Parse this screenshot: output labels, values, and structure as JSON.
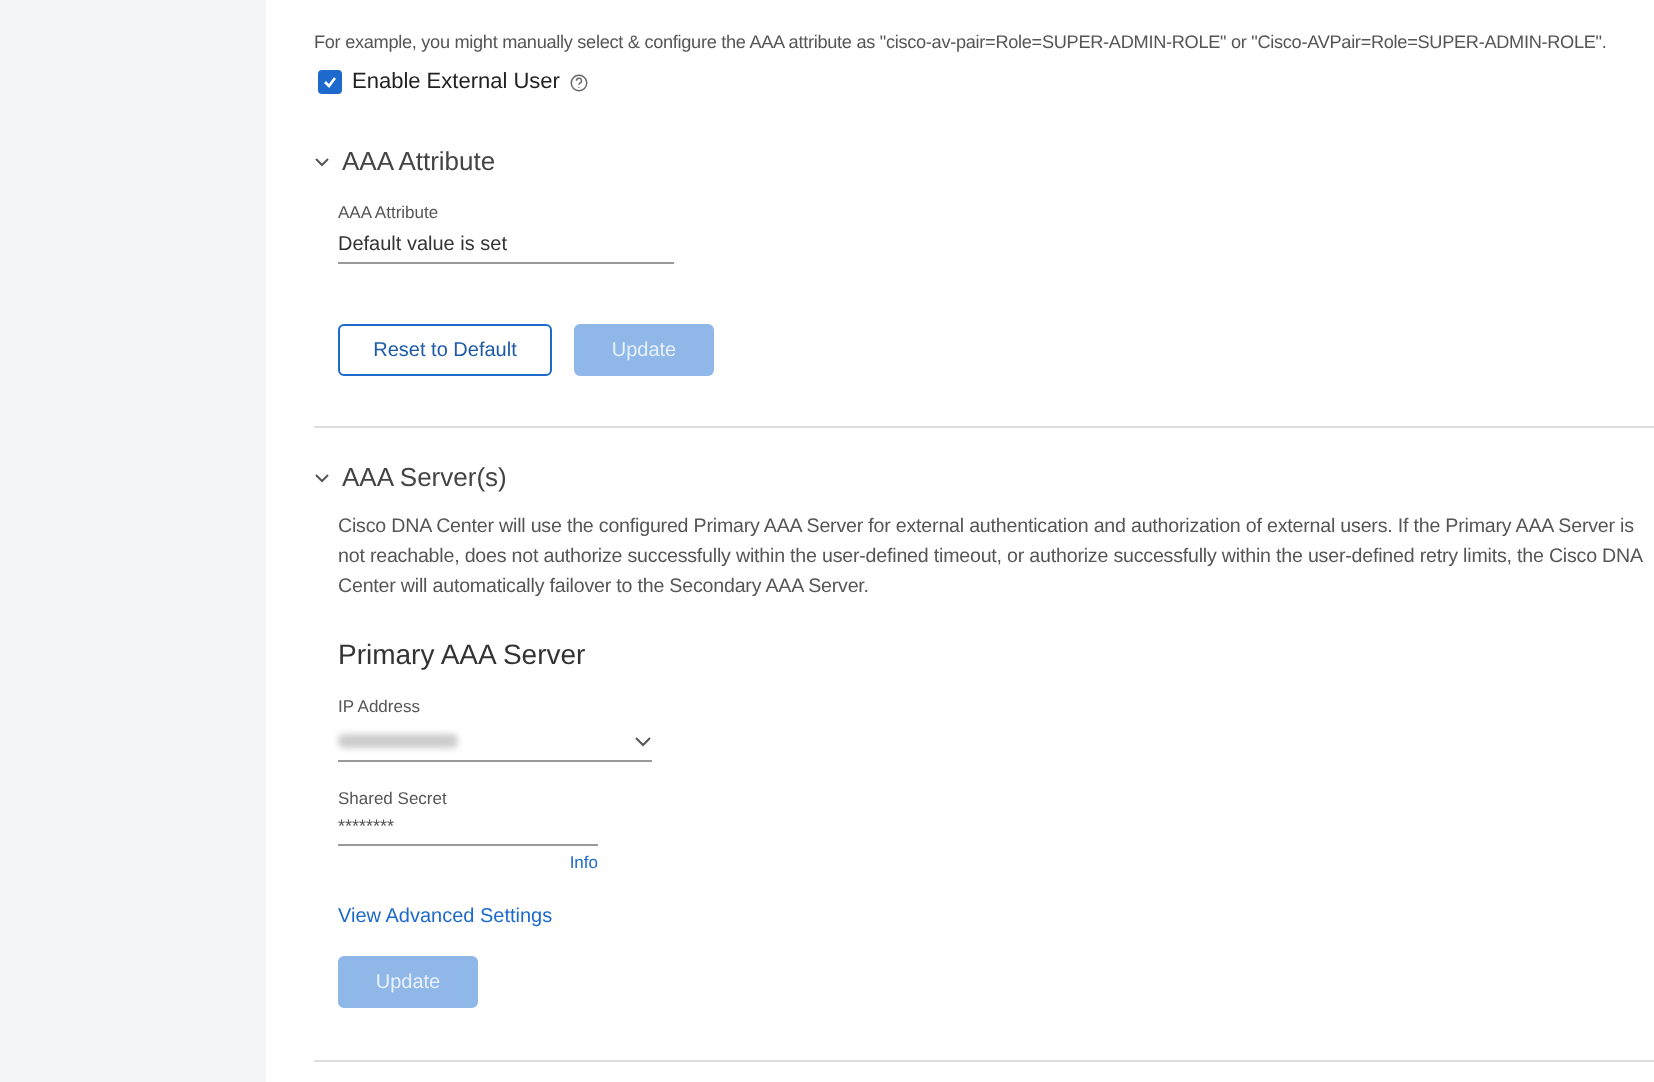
{
  "intro": "For example, you might manually select & configure the AAA attribute as \"cisco-av-pair=Role=SUPER-ADMIN-ROLE\" or \"Cisco-AVPair=Role=SUPER-ADMIN-ROLE\".",
  "enable_external_user": {
    "label": "Enable External User",
    "checked": true
  },
  "aaa_attribute": {
    "title": "AAA Attribute",
    "expanded": true,
    "field": {
      "label": "AAA Attribute",
      "value": "Default value is set"
    },
    "buttons": [
      {
        "label": "Reset to Default",
        "kind": "outline",
        "disabled": false
      },
      {
        "label": "Update",
        "kind": "primary",
        "disabled": true
      }
    ]
  },
  "aaa_servers": {
    "title": "AAA Server(s)",
    "expanded": true,
    "description": "Cisco DNA Center will use the configured Primary AAA Server for external authentication and authorization of external users. If the Primary AAA Server is not reachable, does not authorize successfully within the user-defined timeout, or authorize successfully within the user-defined retry limits, the Cisco DNA Center will automatically failover to the Secondary AAA Server.",
    "primary": {
      "title": "Primary AAA Server",
      "ip_label": "IP Address",
      "secret_label": "Shared Secret",
      "secret_value": "********",
      "info_link": "Info"
    },
    "advanced_link": "View Advanced Settings",
    "button": {
      "label": "Update",
      "kind": "primary",
      "disabled": true
    }
  }
}
